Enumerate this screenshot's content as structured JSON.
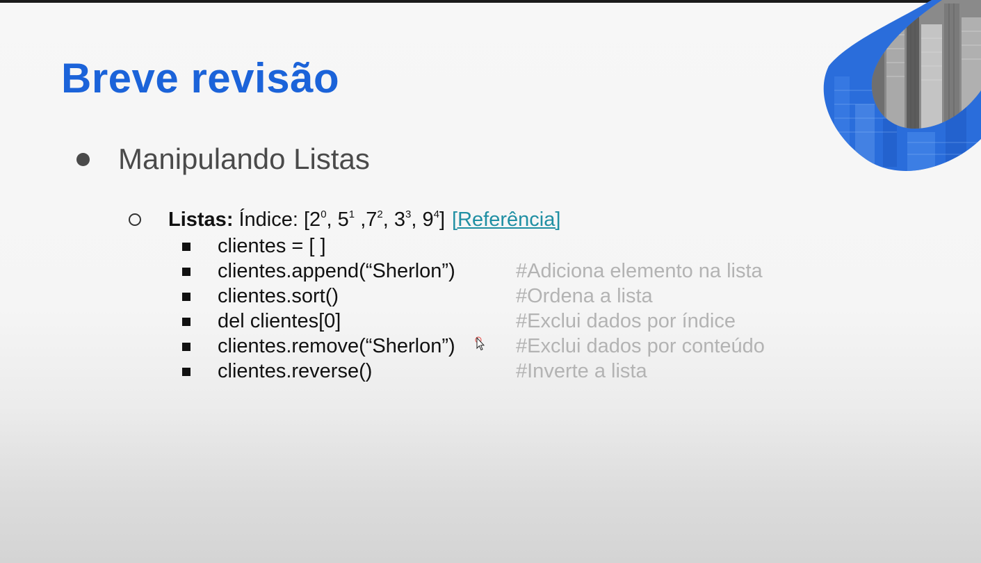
{
  "slide": {
    "title": "Breve revisão",
    "section": "Manipulando Listas",
    "lists_line": {
      "label": "Listas:",
      "index_prefix": "Índice: [",
      "items": [
        {
          "value": "2",
          "index": "0",
          "sep": ", "
        },
        {
          "value": "5",
          "index": "1",
          "sep": " ,"
        },
        {
          "value": "7",
          "index": "2",
          "sep": ", "
        },
        {
          "value": "3",
          "index": "3",
          "sep": ", "
        },
        {
          "value": "9",
          "index": "4",
          "sep": ""
        }
      ],
      "index_suffix": "]",
      "reference_link": "[Referência]"
    },
    "commands": [
      {
        "code": "clientes = [ ]",
        "comment": ""
      },
      {
        "code": "clientes.append(“Sherlon”)",
        "comment": "#Adiciona elemento na lista"
      },
      {
        "code": "clientes.sort()",
        "comment": "#Ordena a lista"
      },
      {
        "code": "del clientes[0]",
        "comment": "#Exclui dados por índice"
      },
      {
        "code": "clientes.remove(“Sherlon”)",
        "comment": "#Exclui dados por conteúdo"
      },
      {
        "code": "clientes.reverse()",
        "comment": "#Inverte a lista"
      }
    ]
  },
  "colors": {
    "title": "#1b63d9",
    "link": "#1f8fa3",
    "comment": "#b3b3b3",
    "decoration_blue": "#2a6ddb"
  },
  "icons": {
    "level1_bullet": "filled-circle-bullet",
    "level2_bullet": "hollow-circle-bullet",
    "level3_bullet": "filled-square-bullet",
    "pointer": "mouse-cursor-icon",
    "decoration": "city-buildings-graphic"
  }
}
